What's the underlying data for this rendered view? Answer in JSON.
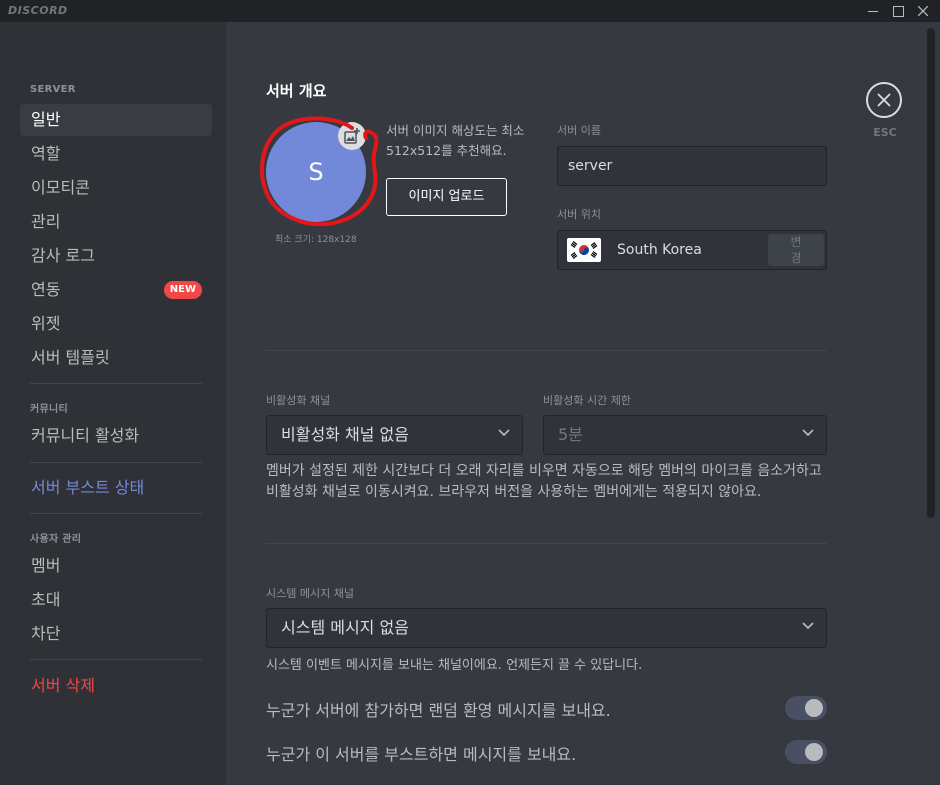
{
  "app": {
    "brand": "DISCORD"
  },
  "sidebar": {
    "header_server": "SERVER",
    "items": [
      {
        "label": "일반"
      },
      {
        "label": "역할"
      },
      {
        "label": "이모티콘"
      },
      {
        "label": "관리"
      },
      {
        "label": "감사 로그"
      },
      {
        "label": "연동",
        "badge": "NEW"
      },
      {
        "label": "위젯"
      },
      {
        "label": "서버 템플릿"
      }
    ],
    "header_community": "커뮤니티",
    "community_item": "커뮤니티 활성화",
    "boost_item": "서버 부스트 상태",
    "header_users": "사용자 관리",
    "user_items": [
      {
        "label": "멤버"
      },
      {
        "label": "초대"
      },
      {
        "label": "차단"
      }
    ],
    "delete_item": "서버 삭제"
  },
  "overview": {
    "title": "서버 개요",
    "avatar_letter": "S",
    "min_size": "최소 크기: 128x128",
    "hint": "서버 이미지 해상도는 최소 512x512를 추천해요.",
    "upload_button": "이미지 업로드",
    "server_name_label": "서버 이름",
    "server_name_value": "server",
    "region_label": "서버 위치",
    "region_value": "South Korea",
    "change_button": "변경"
  },
  "afk": {
    "channel_label": "비활성화 채널",
    "channel_value": "비활성화 채널 없음",
    "timeout_label": "비활성화 시간 제한",
    "timeout_value": "5분",
    "description": "멤버가 설정된 제한 시간보다 더 오래 자리를 비우면 자동으로 해당 멤버의 마이크를 음소거하고 비활성화 채널로 이동시켜요. 브라우저 버전을 사용하는 멤버에게는 적용되지 않아요."
  },
  "system": {
    "channel_label": "시스템 메시지 채널",
    "channel_value": "시스템 메시지 없음",
    "description": "시스템 이벤트 메시지를 보내는 채널이에요. 언제든지 끌 수 있답니다.",
    "toggle_welcome": "누군가 서버에 참가하면 랜덤 환영 메시지를 보내요.",
    "toggle_boost": "누군가 이 서버를 부스트하면 메시지를 보내요."
  },
  "close": {
    "label": "ESC"
  }
}
